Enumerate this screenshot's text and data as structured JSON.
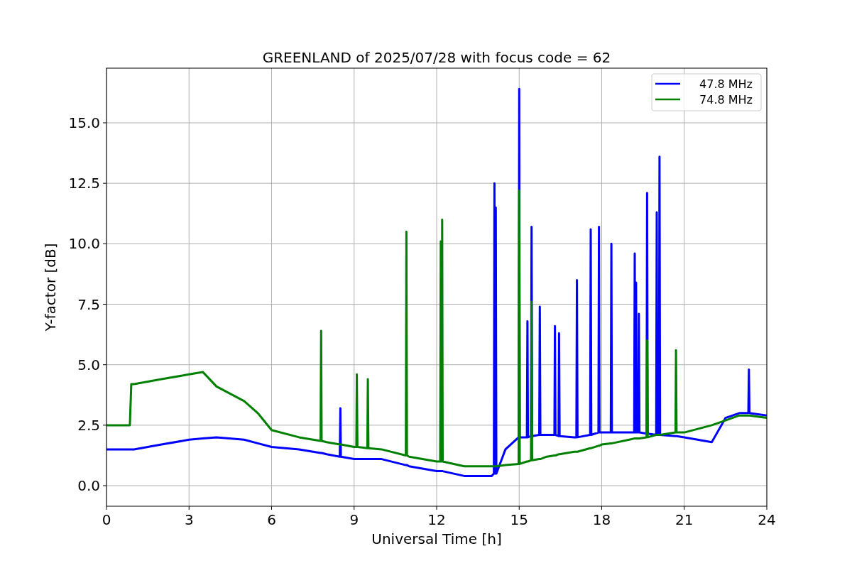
{
  "figure": {
    "chart_data": {
      "type": "line",
      "grid": true,
      "legend": true,
      "title": "GREENLAND of 2025/07/28 with focus code = 62",
      "xlabel": "Universal Time [h]",
      "ylabel": "Y-factor [dB]",
      "xlim": [
        0,
        24
      ],
      "ylim": [
        -0.85,
        17.26
      ],
      "xticks": [
        0,
        3,
        6,
        9,
        12,
        15,
        18,
        21,
        24
      ],
      "yticks": [
        {
          "value": 0,
          "label": "0.0"
        },
        {
          "value": 2.5,
          "label": "2.5"
        },
        {
          "value": 5,
          "label": "5.0"
        },
        {
          "value": 7.5,
          "label": "7.5"
        },
        {
          "value": 10,
          "label": "10.0"
        },
        {
          "value": 12.5,
          "label": "12.5"
        },
        {
          "value": 15,
          "label": "15.0"
        }
      ],
      "x": [
        0,
        0.85,
        0.9,
        1,
        2,
        3,
        3.5,
        4,
        5,
        5.5,
        6,
        7,
        7.78,
        7.8,
        7.82,
        8,
        8.48,
        8.5,
        8.52,
        9,
        9.08,
        9.1,
        9.12,
        9.48,
        9.5,
        9.52,
        10,
        10.88,
        10.9,
        10.92,
        11,
        12,
        12.13,
        12.15,
        12.17,
        12.18,
        12.2,
        12.22,
        13,
        14,
        14.08,
        14.1,
        14.12,
        14.13,
        14.15,
        14.17,
        14.5,
        14.98,
        15,
        15.02,
        15.28,
        15.3,
        15.32,
        15.43,
        15.45,
        15.47,
        15.73,
        15.75,
        15.77,
        16,
        16.28,
        16.3,
        16.32,
        16.43,
        16.45,
        16.47,
        17,
        17.08,
        17.1,
        17.12,
        17.58,
        17.6,
        17.62,
        17.88,
        17.9,
        17.92,
        18,
        18.33,
        18.35,
        18.37,
        19,
        19.18,
        19.2,
        19.22,
        19.23,
        19.25,
        19.27,
        19.33,
        19.35,
        19.37,
        19.63,
        19.65,
        19.67,
        19.98,
        20,
        20.02,
        20.08,
        20.1,
        20.12,
        20.68,
        20.7,
        20.72,
        21,
        22,
        22.5,
        23,
        23.33,
        23.35,
        23.37,
        24
      ],
      "series": [
        {
          "name": "47.8 MHz",
          "color": "#0000ff",
          "values": [
            1.5,
            1.5,
            1.5,
            1.5,
            1.7,
            1.9,
            1.95,
            2.0,
            1.9,
            1.75,
            1.6,
            1.5,
            1.35,
            1.35,
            1.35,
            1.3,
            1.2,
            3.2,
            1.2,
            1.1,
            1.1,
            1.1,
            1.1,
            1.1,
            1.1,
            1.1,
            1.1,
            0.85,
            0.85,
            0.85,
            0.8,
            0.6,
            0.6,
            0.6,
            0.6,
            0.6,
            0.6,
            0.6,
            0.4,
            0.4,
            0.5,
            12.5,
            0.5,
            0.5,
            11.5,
            0.5,
            1.5,
            2.0,
            16.4,
            2.0,
            2.0,
            6.8,
            2.0,
            2.05,
            10.7,
            2.05,
            2.1,
            7.4,
            2.1,
            2.1,
            2.1,
            6.6,
            2.1,
            2.05,
            6.3,
            2.05,
            2.0,
            2.0,
            8.5,
            2.0,
            2.1,
            10.6,
            2.1,
            2.2,
            10.7,
            2.2,
            2.2,
            2.2,
            10.0,
            2.2,
            2.2,
            2.2,
            9.6,
            2.2,
            2.2,
            8.4,
            2.2,
            2.2,
            7.1,
            2.2,
            2.15,
            12.1,
            2.15,
            2.1,
            11.3,
            2.1,
            2.1,
            13.6,
            2.1,
            2.05,
            2.05,
            2.05,
            2.0,
            1.8,
            2.8,
            3.0,
            3.0,
            4.8,
            3.0,
            2.9
          ]
        },
        {
          "name": "74.8 MHz",
          "color": "#008000",
          "values": [
            2.5,
            2.5,
            4.2,
            4.2,
            4.4,
            4.6,
            4.7,
            4.1,
            3.5,
            3.0,
            2.3,
            2.0,
            1.85,
            6.4,
            1.85,
            1.8,
            1.7,
            1.7,
            1.7,
            1.6,
            1.6,
            4.6,
            1.6,
            1.55,
            4.4,
            1.55,
            1.5,
            1.25,
            10.5,
            1.25,
            1.2,
            1.0,
            1.0,
            10.1,
            1.0,
            1.0,
            11.0,
            1.0,
            0.8,
            0.8,
            0.8,
            0.8,
            0.8,
            0.8,
            0.8,
            0.8,
            0.85,
            0.9,
            12.2,
            0.9,
            1.0,
            1.0,
            1.0,
            1.05,
            7.6,
            1.05,
            1.1,
            1.1,
            1.1,
            1.2,
            1.25,
            1.25,
            1.25,
            1.3,
            1.3,
            1.3,
            1.4,
            1.4,
            1.4,
            1.4,
            1.55,
            1.55,
            1.55,
            1.65,
            1.65,
            1.65,
            1.7,
            1.75,
            1.75,
            1.75,
            1.9,
            1.95,
            1.95,
            1.95,
            1.95,
            1.95,
            1.95,
            1.95,
            1.95,
            1.95,
            2.0,
            6.0,
            2.0,
            2.1,
            2.1,
            2.1,
            2.1,
            2.1,
            2.1,
            2.2,
            5.6,
            2.2,
            2.2,
            2.5,
            2.7,
            2.9,
            2.9,
            2.9,
            2.9,
            2.8
          ]
        }
      ]
    }
  }
}
